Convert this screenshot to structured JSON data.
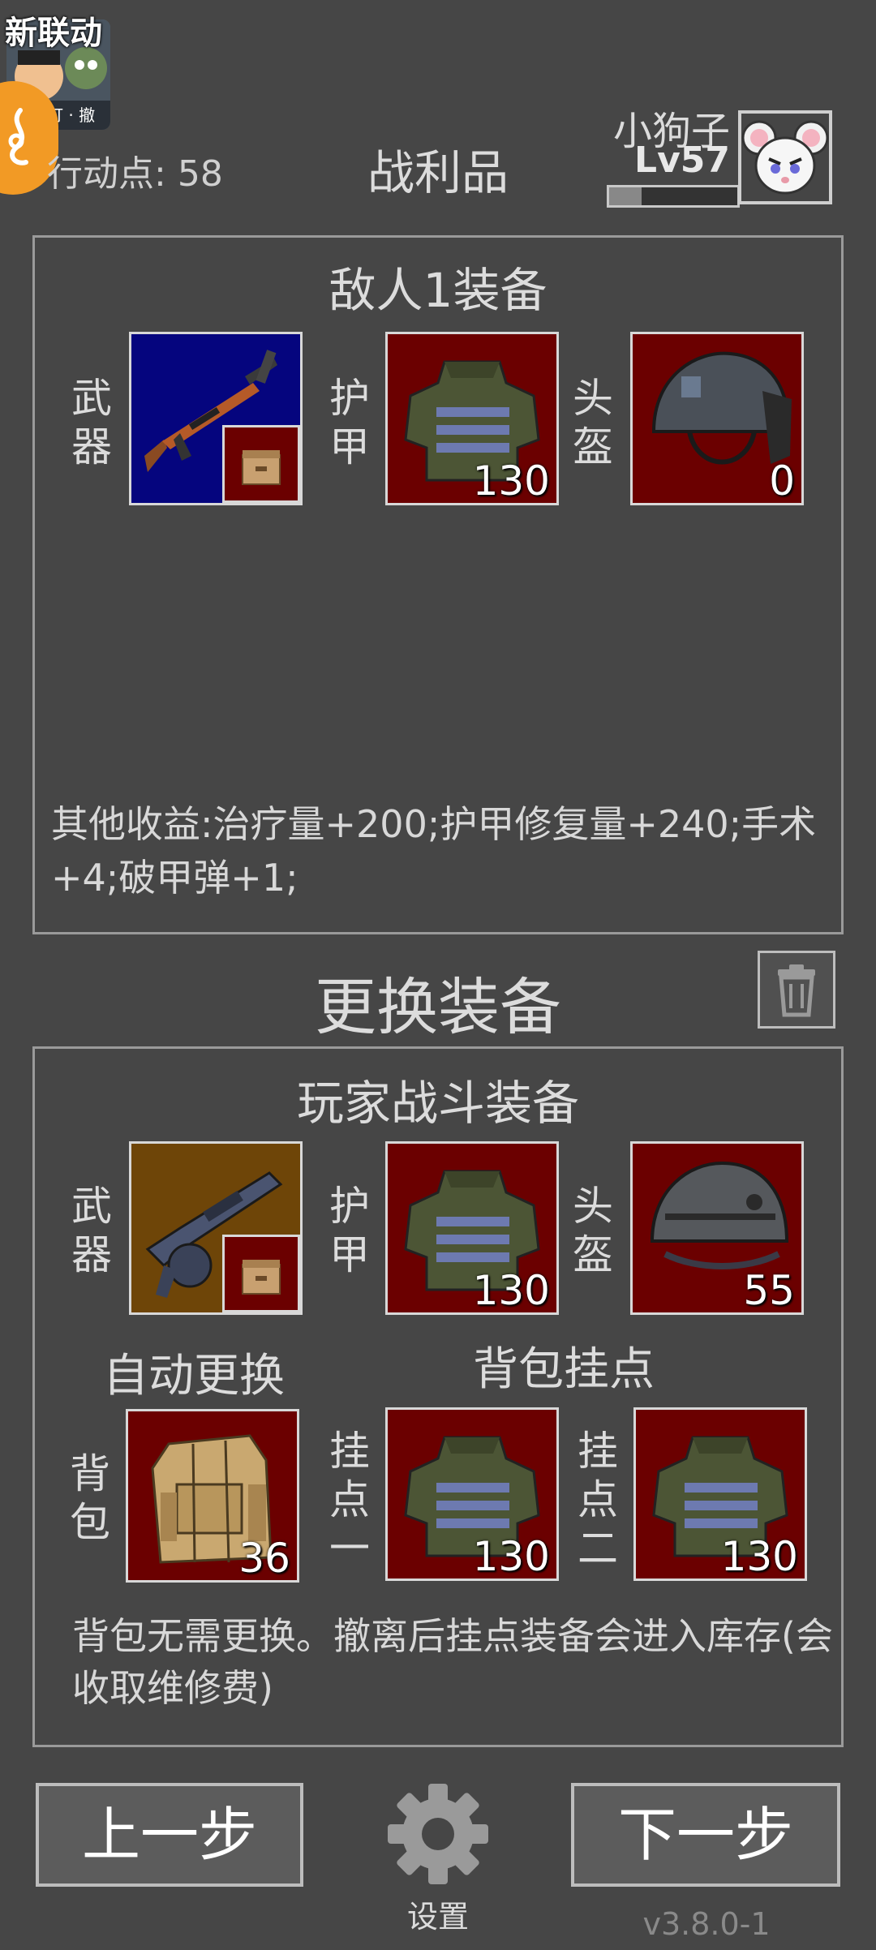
{
  "collab_badge": {
    "label": "新联动",
    "caption": "打 · 撤"
  },
  "header": {
    "action_points_label": "行动点:",
    "action_points_value": "58",
    "title": "战利品",
    "player_name": "小狗子",
    "player_level": "Lv57",
    "xp_progress": 0.25
  },
  "enemy_panel": {
    "title": "敌人1装备",
    "weapon_label": "武器",
    "armor_label": "护甲",
    "helmet_label": "头盔",
    "armor_value": "130",
    "helmet_value": "0",
    "other_gains": "其他收益:治疗量+200;护甲修复量+240;手术+4;破甲弹+1;"
  },
  "change_section": {
    "title": "更换装备"
  },
  "player_panel": {
    "title": "玩家战斗装备",
    "weapon_label": "武器",
    "armor_label": "护甲",
    "helmet_label": "头盔",
    "armor_value": "130",
    "helmet_value": "55",
    "auto_replace_label": "自动更换",
    "backpack_mount_title": "背包挂点",
    "backpack_label": "背包",
    "backpack_value": "36",
    "mount1_label": "挂点一",
    "mount1_value": "130",
    "mount2_label": "挂点二",
    "mount2_value": "130",
    "note": "背包无需更换。撤离后挂点装备会进入库存(会收取维修费)"
  },
  "footer": {
    "prev_label": "上一步",
    "next_label": "下一步",
    "settings_label": "设置",
    "version": "v3.8.0-1"
  },
  "colors": {
    "background": "#464646",
    "slot_red": "#6b0000",
    "slot_blue": "#05057e",
    "slot_brown": "#6e4508",
    "accent_orange": "#f29a25"
  }
}
